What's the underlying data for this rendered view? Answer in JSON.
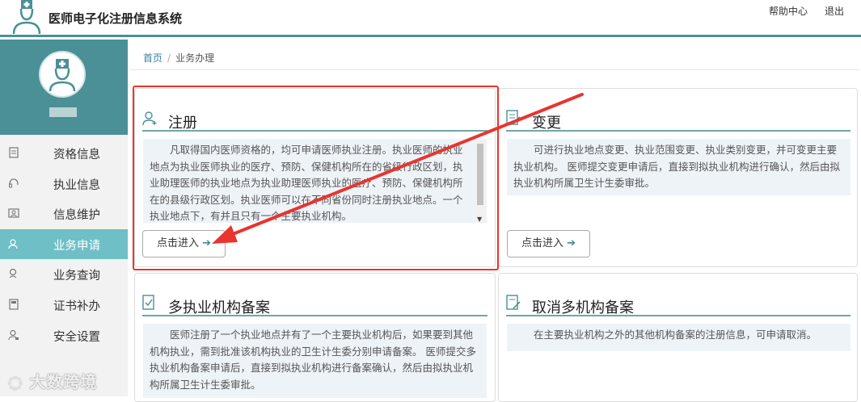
{
  "header": {
    "app_title": "医师电子化注册信息系统",
    "help_label": "帮助中心",
    "logout_label": "退出"
  },
  "sidebar": {
    "items": [
      {
        "label": "资格信息",
        "icon": "document-icon"
      },
      {
        "label": "执业信息",
        "icon": "headset-icon"
      },
      {
        "label": "信息维护",
        "icon": "id-card-icon"
      },
      {
        "label": "业务申请",
        "icon": "user-icon",
        "active": true
      },
      {
        "label": "业务查询",
        "icon": "search-user-icon"
      },
      {
        "label": "证书补办",
        "icon": "certificate-icon"
      },
      {
        "label": "安全设置",
        "icon": "user-lock-icon"
      }
    ]
  },
  "breadcrumb": {
    "home": "首页",
    "current": "业务办理"
  },
  "cards": {
    "register": {
      "title": "注册",
      "desc": "凡取得国内医师资格的，均可申请医师执业注册。执业医师的执业地点为执业医师执业的医疗、预防、保健机构所在的省级行政区划，执业助理医师的执业地点为执业助理医师执业的医疗、预防、保健机构所在的县级行政区划。执业医师可以在不同省份同时注册执业地点。一个执业地点下，有并且只有一个主要执业机构。",
      "button": "点击进入"
    },
    "change": {
      "title": "变更",
      "desc": "可进行执业地点变更、执业范围变更、执业类别变更，并可变更主要执业机构。 医师提交变更申请后，直接到拟执业机构进行确认，然后由拟执业机构所属卫生计生委审批。",
      "button": "点击进入"
    },
    "multi": {
      "title": "多执业机构备案",
      "desc": "医师注册了一个执业地点并有了一个主要执业机构后，如果要到其他机构执业，需到批准该机构执业的卫生计生委分别申请备案。 医师提交多执业机构备案申请后，直接到拟执业机构进行备案确认，然后由拟执业机构所属卫生计生委审批。"
    },
    "cancel_multi": {
      "title": "取消多机构备案",
      "desc": "在主要执业机构之外的其他机构备案的注册信息，可申请取消。"
    }
  },
  "watermark": "大数跨境",
  "colors": {
    "primary": "#4a9096",
    "active_nav": "#6fbfc6",
    "highlight": "#e8352e"
  }
}
